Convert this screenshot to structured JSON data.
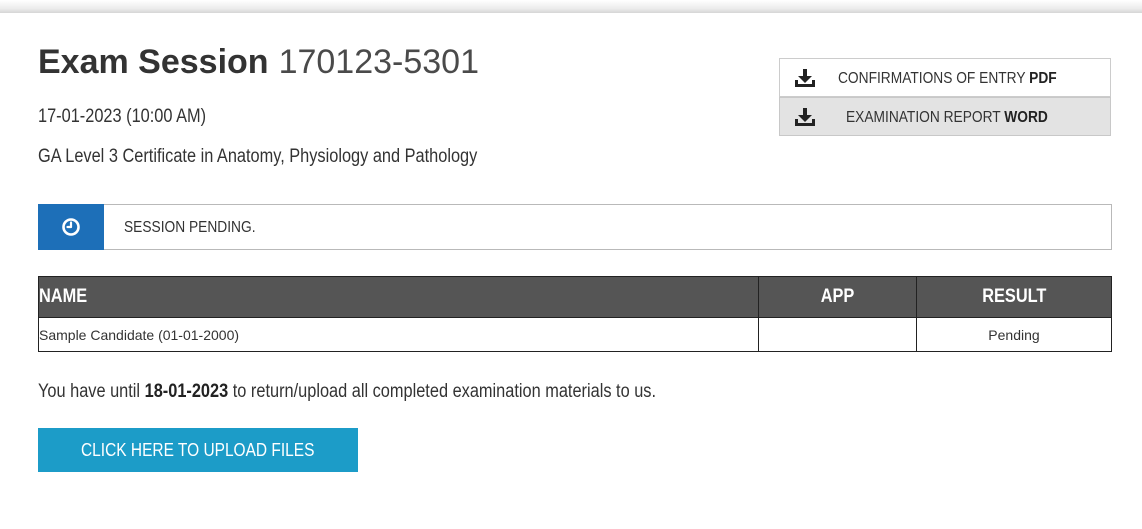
{
  "header": {
    "title_bold": "Exam Session",
    "session_id": "170123-5301",
    "datetime": "17-01-2023 (10:00 AM)",
    "course": "GA Level 3 Certificate in Anatomy, Physiology and Pathology"
  },
  "downloads": [
    {
      "label": "CONFIRMATIONS OF ENTRY",
      "format": "PDF",
      "icon": "download-icon"
    },
    {
      "label": "EXAMINATION REPORT",
      "format": "WORD",
      "icon": "download-icon"
    }
  ],
  "status": {
    "icon": "clock-icon",
    "text": "SESSION PENDING.",
    "color": "#1d6fb8"
  },
  "table": {
    "headers": [
      "NAME",
      "APP",
      "RESULT"
    ],
    "rows": [
      {
        "name": "Sample Candidate (01-01-2000)",
        "app": "",
        "result": "Pending"
      }
    ]
  },
  "deadline": {
    "prefix": "You have until",
    "date": "18-01-2023",
    "suffix": "to return/upload all completed examination materials to us."
  },
  "upload_button": {
    "label": "CLICK HERE TO UPLOAD FILES",
    "color": "#1c9cc8"
  }
}
